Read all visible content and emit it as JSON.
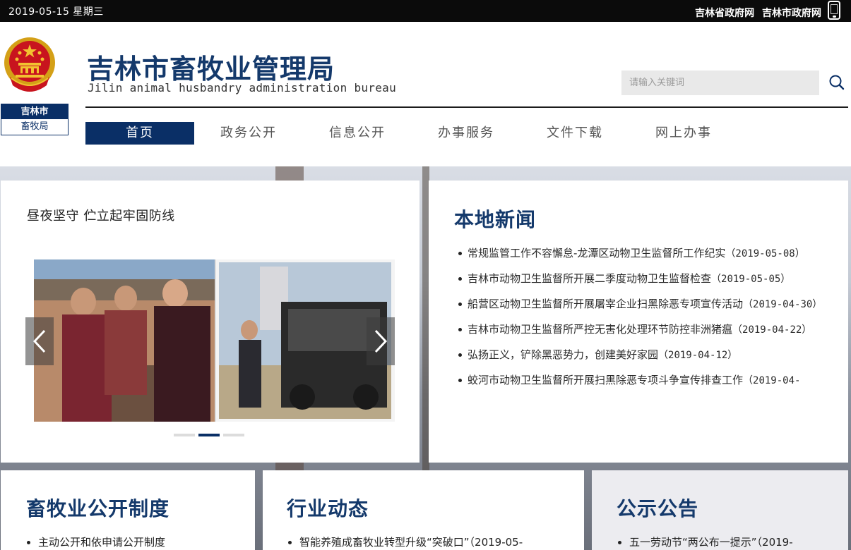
{
  "topbar": {
    "date": "2019-05-15 星期三",
    "links": [
      "吉林省政府网",
      "吉林市政府网"
    ]
  },
  "header": {
    "org_line1": "吉林市",
    "org_line2": "畜牧局",
    "title": "吉林市畜牧业管理局",
    "subtitle": "Jilin animal husbandry administration bureau",
    "search_placeholder": "请输入关键词"
  },
  "nav": {
    "items": [
      "首页",
      "政务公开",
      "信息公开",
      "办事服务",
      "文件下载",
      "网上办事"
    ],
    "active_index": 0
  },
  "carousel": {
    "title": "昼夜坚守 伫立起牢固防线",
    "slide_count": 3,
    "active_slide": 1
  },
  "local_news": {
    "title": "本地新闻",
    "items": [
      {
        "text": "常规监管工作不容懈怠-龙潭区动物卫生监督所工作纪实",
        "date": "（2019-05-08）"
      },
      {
        "text": "吉林市动物卫生监督所开展二季度动物卫生监督检查",
        "date": "（2019-05-05）"
      },
      {
        "text": "船营区动物卫生监督所开展屠宰企业扫黑除恶专项宣传活动",
        "date": "（2019-04-30）"
      },
      {
        "text": "吉林市动物卫生监督所严控无害化处理环节防控非洲猪瘟",
        "date": "（2019-04-22）"
      },
      {
        "text": "弘扬正义，铲除黑恶势力，创建美好家园",
        "date": "（2019-04-12）"
      },
      {
        "text": "蛟河市动物卫生监督所开展扫黑除恶专项斗争宣传排查工作",
        "date": "（2019-04-"
      }
    ]
  },
  "section_disclosure": {
    "title": "畜牧业公开制度",
    "items": [
      "主动公开和依申请公开制度"
    ]
  },
  "section_industry": {
    "title": "行业动态",
    "items": [
      "智能养殖成畜牧业转型升级“突破口”（2019-05-"
    ]
  },
  "section_notice": {
    "title": "公示公告",
    "items": [
      "五一劳动节“两公布一提示”（2019-"
    ]
  },
  "colors": {
    "brand_navy": "#0a2f66",
    "title_blue": "#14396b",
    "topbar_black": "#0b0b0b"
  }
}
